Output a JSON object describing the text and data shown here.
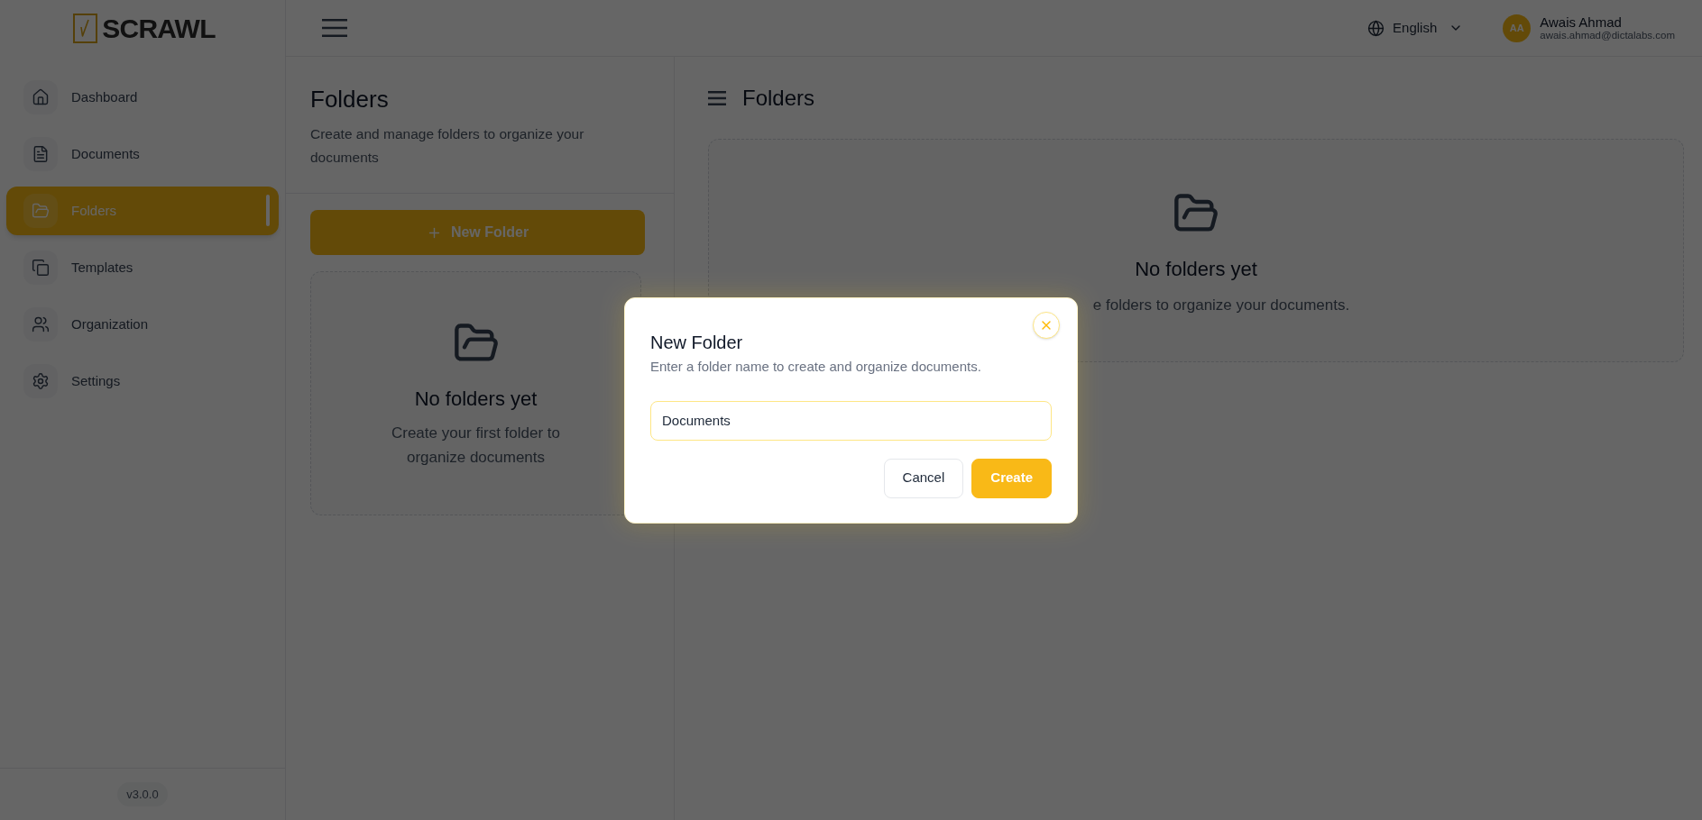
{
  "sidebar": {
    "logo": "SCRAWL",
    "items": [
      {
        "label": "Dashboard",
        "selected": false
      },
      {
        "label": "Documents",
        "selected": false
      },
      {
        "label": "Folders",
        "selected": true
      },
      {
        "label": "Templates",
        "selected": false
      },
      {
        "label": "Organization",
        "selected": false
      },
      {
        "label": "Settings",
        "selected": false
      }
    ],
    "version": "v3.0.0"
  },
  "header": {
    "language": "English",
    "user": {
      "initials": "AA",
      "name": "Awais Ahmad",
      "email": "awais.ahmad@dictalabs.com"
    }
  },
  "folders_panel": {
    "title": "Folders",
    "description": "Create and manage folders to organize your documents",
    "new_button": "New Folder",
    "empty_state": {
      "title": "No folders yet",
      "text": "Create your first folder to organize documents"
    }
  },
  "content": {
    "title": "Folders",
    "empty_state": {
      "title": "No folders yet",
      "text": "e folders to organize your documents."
    }
  },
  "dialog": {
    "title": "New Folder",
    "description": "Enter a folder name to create and organize documents.",
    "input_value": "Documents",
    "buttons": [
      {
        "label": "Cancel",
        "kind": "secondary"
      },
      {
        "label": "Create",
        "kind": "primary"
      }
    ]
  }
}
